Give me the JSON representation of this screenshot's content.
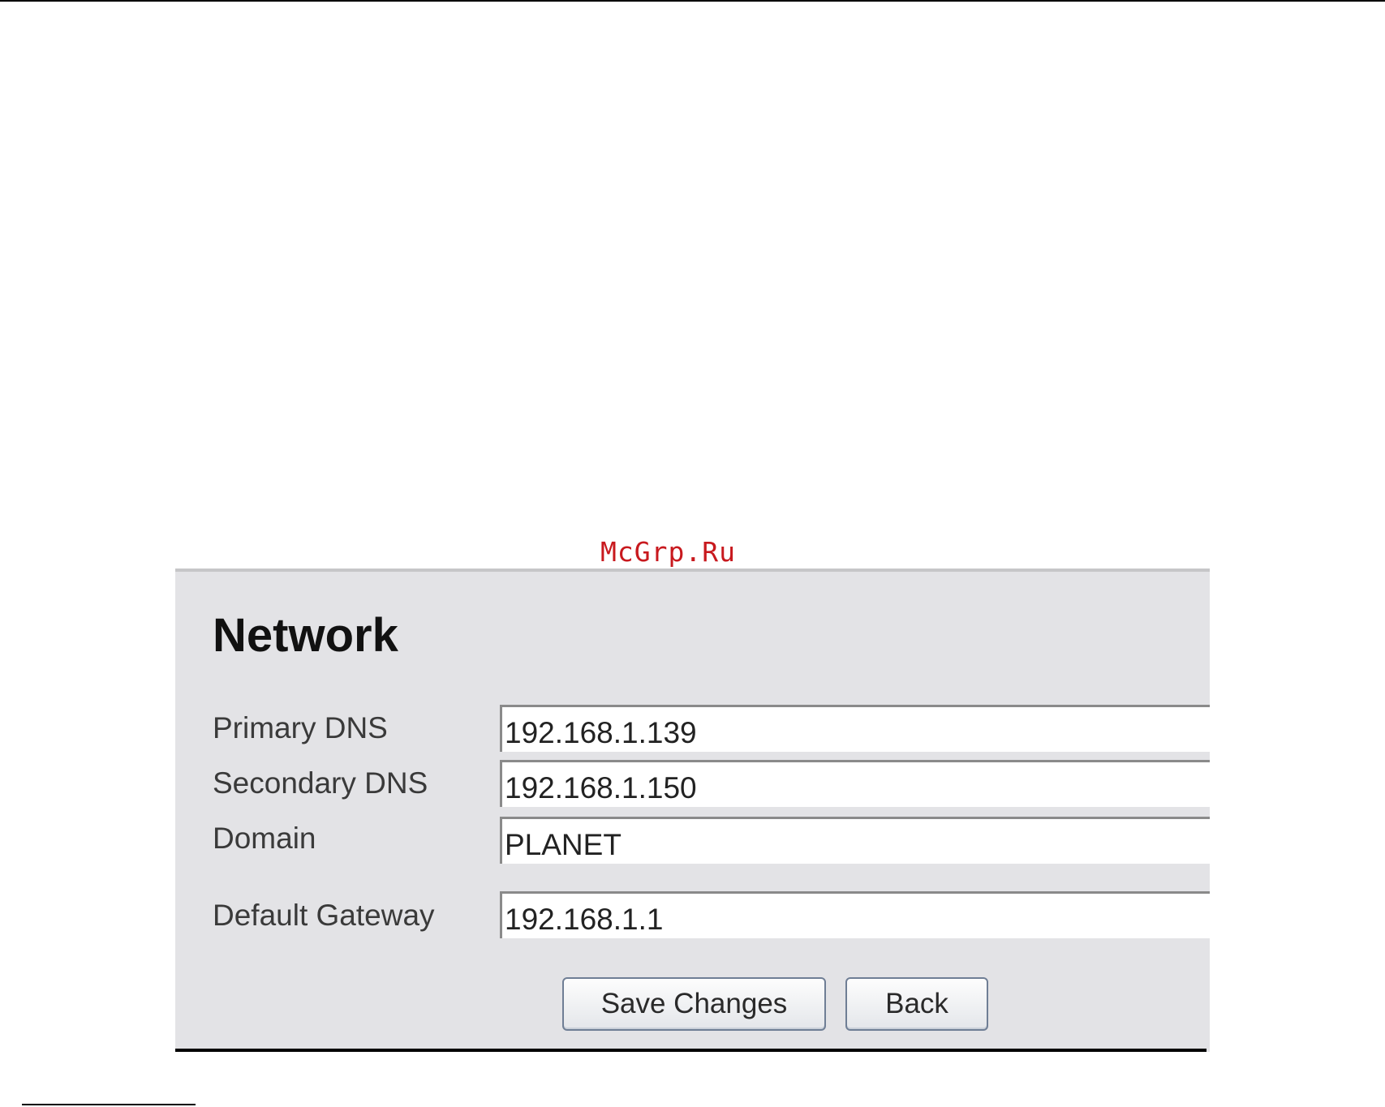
{
  "watermark": "McGrp.Ru",
  "panel": {
    "title": "Network",
    "fields": [
      {
        "label": "Primary DNS",
        "value": "192.168.1.139"
      },
      {
        "label": "Secondary DNS",
        "value": "192.168.1.150"
      },
      {
        "label": "Domain",
        "value": "PLANET"
      },
      {
        "label": "Default Gateway",
        "value": "192.168.1.1"
      }
    ],
    "buttons": {
      "save": "Save Changes",
      "back": "Back"
    }
  }
}
